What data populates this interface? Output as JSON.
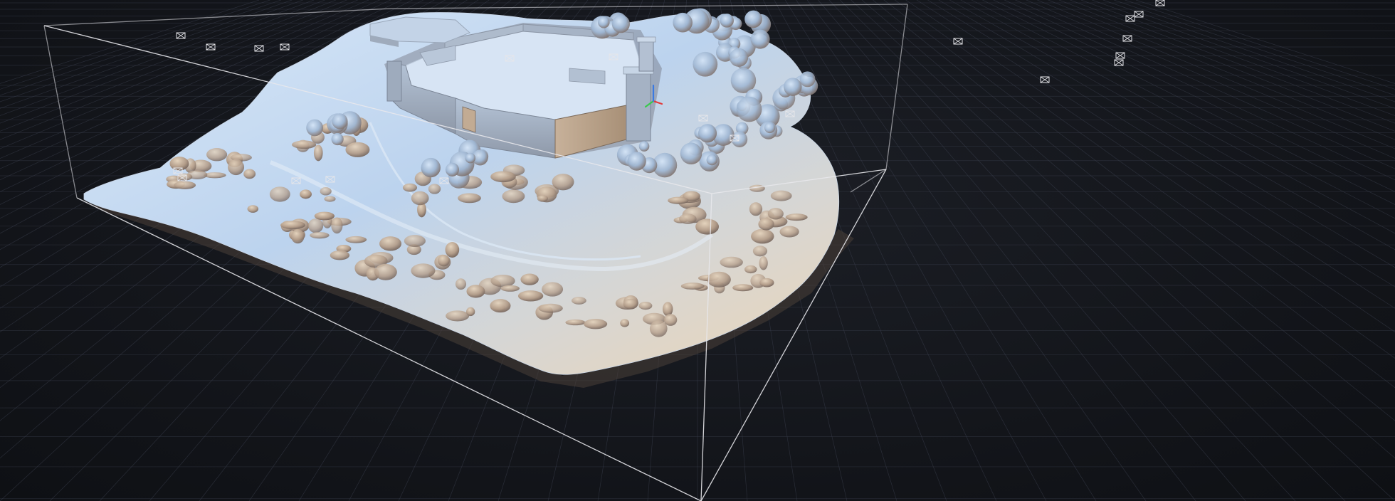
{
  "viewport": {
    "label": "",
    "background_color": "#15171c",
    "grid_color": "#3c4150",
    "grid_major_color": "#555b6b",
    "bounding_box_color": "#e8e8ec",
    "mesh_light_color": "#cfe0f4",
    "mesh_mid_color": "#a9c3e2",
    "mesh_warm_color": "#e9d6bd",
    "mesh_shadow_color": "#7f6f66",
    "icons": {
      "camera": "camera-frustum-icon",
      "gizmo": "xyz-axis-gizmo-icon"
    },
    "gizmo_axis_colors": {
      "x": "#e23a3a",
      "y": "#38c94c",
      "z": "#3a7ae2"
    },
    "camera_count": 22
  }
}
